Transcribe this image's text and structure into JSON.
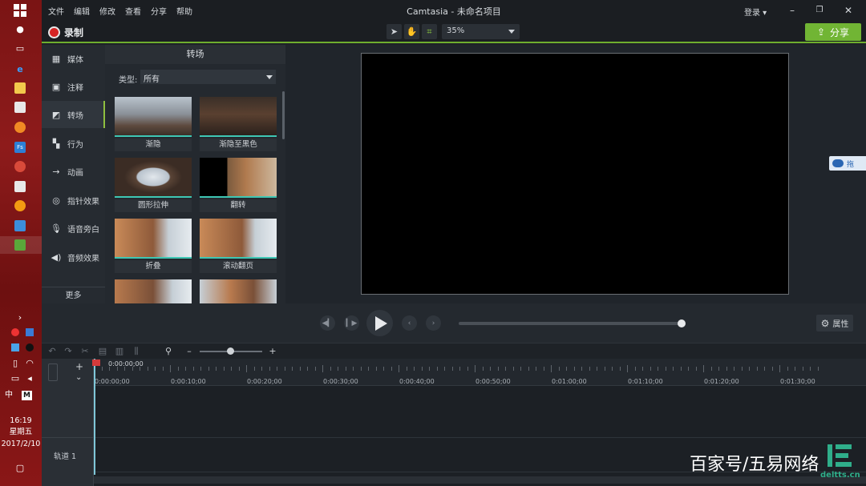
{
  "taskbar": {
    "clock_time": "16:19",
    "clock_day": "星期五",
    "clock_date": "2017/2/10",
    "ime": "中",
    "ime_mode": "M"
  },
  "menubar": {
    "items": [
      "文件",
      "编辑",
      "修改",
      "查看",
      "分享",
      "帮助"
    ],
    "title": "Camtasia - 未命名项目",
    "login": "登录 ▾"
  },
  "toolbar": {
    "record_label": "录制",
    "zoom_value": "35%",
    "share_label": "分享"
  },
  "sidetabs": {
    "items": [
      "媒体",
      "注释",
      "转场",
      "行为",
      "动画",
      "指针效果",
      "语音旁白",
      "音频效果"
    ],
    "more_label": "更多"
  },
  "panel": {
    "title": "转场",
    "type_label": "类型:",
    "type_value": "所有",
    "thumbnails": [
      "渐隐",
      "渐隐至黑色",
      "圆形拉伸",
      "翻转",
      "折叠",
      "滚动翻页"
    ]
  },
  "side_tab": {
    "label": "拖"
  },
  "playbar": {
    "props_label": "属性"
  },
  "timeline": {
    "playhead_time": "0:00:00;00",
    "ruler_labels": [
      "0:00:00;00",
      "0:00:10;00",
      "0:00:20;00",
      "0:00:30;00",
      "0:00:40;00",
      "0:00:50;00",
      "0:01:00;00",
      "0:01:10;00",
      "0:01:20;00",
      "0:01:30;00"
    ],
    "track_label": "轨道 1"
  },
  "watermark": {
    "text": "百家号/五易网络",
    "sub": "deltts.cn"
  },
  "colors": {
    "accent_green": "#71b534",
    "transition_line": "#3ec7b4",
    "record_red": "#d52424"
  }
}
